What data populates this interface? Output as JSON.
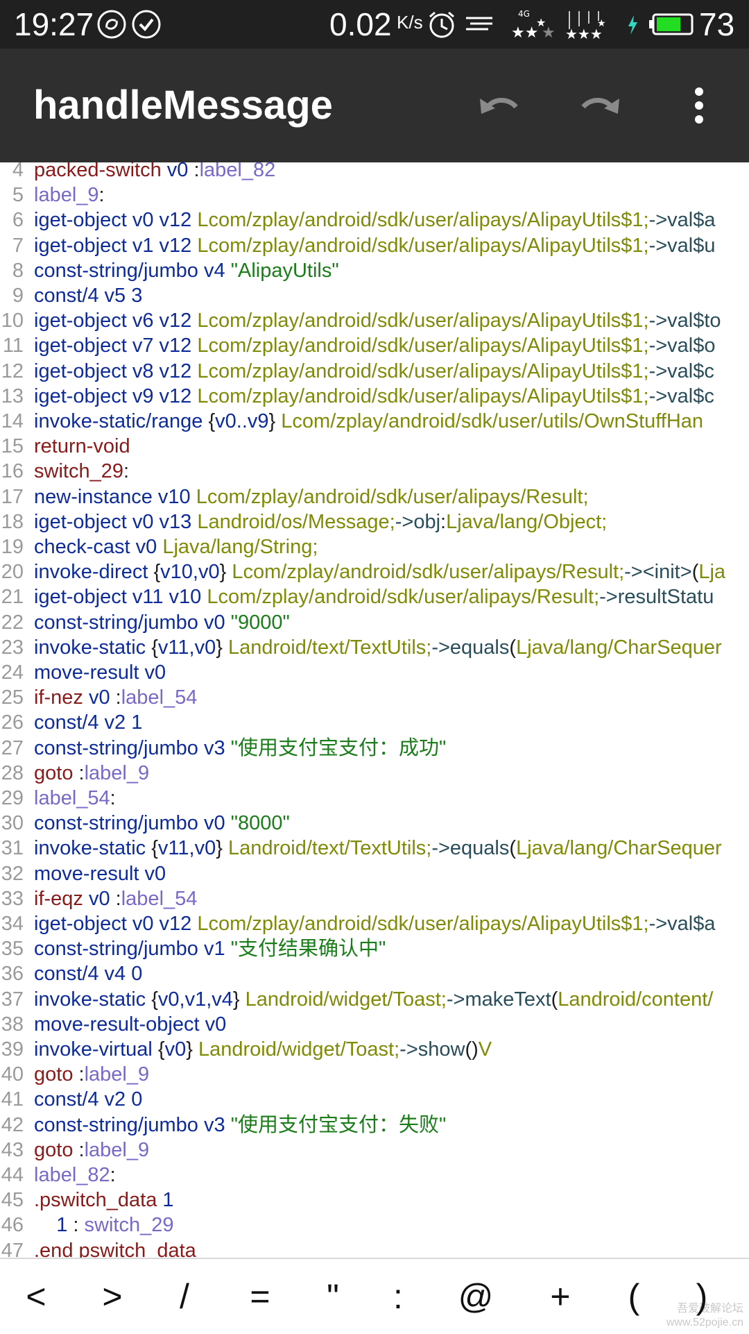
{
  "status_bar": {
    "time": "19:27",
    "speed": "0.02",
    "speed_unit": "K/s",
    "network": "4G",
    "battery_level": "73",
    "icons": [
      "sync-icon",
      "check-circle-icon",
      "alarm-icon",
      "menu-lines-icon",
      "signal-stars-icon",
      "signal-stars-icon",
      "charging-bolt-icon",
      "battery-icon"
    ]
  },
  "toolbar": {
    "title": "handleMessage",
    "icons": [
      "undo-icon",
      "redo-icon",
      "more-vert-icon"
    ]
  },
  "editor": {
    "lines": [
      {
        "n": "4",
        "tokens": [
          {
            "t": "packed-switch",
            "c": "ctrl"
          },
          {
            "t": " v0 ",
            "c": "reg"
          },
          {
            "t": ":",
            "c": "punct"
          },
          {
            "t": "label_82",
            "c": "label"
          }
        ]
      },
      {
        "n": "5",
        "tokens": [
          {
            "t": "label_9",
            "c": "label"
          },
          {
            "t": ":",
            "c": "punct"
          }
        ]
      },
      {
        "n": "6",
        "tokens": [
          {
            "t": "iget-object",
            "c": "op"
          },
          {
            "t": " v0 v12 ",
            "c": "reg"
          },
          {
            "t": "Lcom/zplay/android/sdk/user/alipays/AlipayUtils$1;",
            "c": "type"
          },
          {
            "t": "->",
            "c": "member"
          },
          {
            "t": "val$a",
            "c": "member"
          }
        ]
      },
      {
        "n": "7",
        "tokens": [
          {
            "t": "iget-object",
            "c": "op"
          },
          {
            "t": " v1 v12 ",
            "c": "reg"
          },
          {
            "t": "Lcom/zplay/android/sdk/user/alipays/AlipayUtils$1;",
            "c": "type"
          },
          {
            "t": "->",
            "c": "member"
          },
          {
            "t": "val$u",
            "c": "member"
          }
        ]
      },
      {
        "n": "8",
        "tokens": [
          {
            "t": "const-string/jumbo",
            "c": "op"
          },
          {
            "t": " v4 ",
            "c": "reg"
          },
          {
            "t": "\"AlipayUtils\"",
            "c": "str"
          }
        ]
      },
      {
        "n": "9",
        "tokens": [
          {
            "t": "const/4",
            "c": "op"
          },
          {
            "t": " v5 3",
            "c": "reg"
          }
        ]
      },
      {
        "n": "10",
        "tokens": [
          {
            "t": "iget-object",
            "c": "op"
          },
          {
            "t": " v6 v12 ",
            "c": "reg"
          },
          {
            "t": "Lcom/zplay/android/sdk/user/alipays/AlipayUtils$1;",
            "c": "type"
          },
          {
            "t": "->",
            "c": "member"
          },
          {
            "t": "val$to",
            "c": "member"
          }
        ]
      },
      {
        "n": "11",
        "tokens": [
          {
            "t": "iget-object",
            "c": "op"
          },
          {
            "t": " v7 v12 ",
            "c": "reg"
          },
          {
            "t": "Lcom/zplay/android/sdk/user/alipays/AlipayUtils$1;",
            "c": "type"
          },
          {
            "t": "->",
            "c": "member"
          },
          {
            "t": "val$o",
            "c": "member"
          }
        ]
      },
      {
        "n": "12",
        "tokens": [
          {
            "t": "iget-object",
            "c": "op"
          },
          {
            "t": " v8 v12 ",
            "c": "reg"
          },
          {
            "t": "Lcom/zplay/android/sdk/user/alipays/AlipayUtils$1;",
            "c": "type"
          },
          {
            "t": "->",
            "c": "member"
          },
          {
            "t": "val$c",
            "c": "member"
          }
        ]
      },
      {
        "n": "13",
        "tokens": [
          {
            "t": "iget-object",
            "c": "op"
          },
          {
            "t": " v9 v12 ",
            "c": "reg"
          },
          {
            "t": "Lcom/zplay/android/sdk/user/alipays/AlipayUtils$1;",
            "c": "type"
          },
          {
            "t": "->",
            "c": "member"
          },
          {
            "t": "val$c",
            "c": "member"
          }
        ]
      },
      {
        "n": "14",
        "tokens": [
          {
            "t": "invoke-static/range",
            "c": "op"
          },
          {
            "t": " {",
            "c": "punct"
          },
          {
            "t": "v0..v9",
            "c": "reg"
          },
          {
            "t": "} ",
            "c": "punct"
          },
          {
            "t": "Lcom/zplay/android/sdk/user/utils/OwnStuffHan",
            "c": "type"
          }
        ]
      },
      {
        "n": "15",
        "tokens": [
          {
            "t": "return-void",
            "c": "ctrl"
          }
        ]
      },
      {
        "n": "16",
        "tokens": [
          {
            "t": "switch_29",
            "c": "ctrl"
          },
          {
            "t": ":",
            "c": "punct"
          }
        ]
      },
      {
        "n": "17",
        "tokens": [
          {
            "t": "new-instance",
            "c": "op"
          },
          {
            "t": " v10 ",
            "c": "reg"
          },
          {
            "t": "Lcom/zplay/android/sdk/user/alipays/Result;",
            "c": "type"
          }
        ]
      },
      {
        "n": "18",
        "tokens": [
          {
            "t": "iget-object",
            "c": "op"
          },
          {
            "t": " v0 v13 ",
            "c": "reg"
          },
          {
            "t": "Landroid/os/Message;",
            "c": "type"
          },
          {
            "t": "->",
            "c": "member"
          },
          {
            "t": "obj",
            "c": "member"
          },
          {
            "t": ":",
            "c": "punct"
          },
          {
            "t": "Ljava/lang/Object;",
            "c": "type"
          }
        ]
      },
      {
        "n": "19",
        "tokens": [
          {
            "t": "check-cast",
            "c": "op"
          },
          {
            "t": " v0 ",
            "c": "reg"
          },
          {
            "t": "Ljava/lang/String;",
            "c": "type"
          }
        ]
      },
      {
        "n": "20",
        "tokens": [
          {
            "t": "invoke-direct",
            "c": "op"
          },
          {
            "t": " {",
            "c": "punct"
          },
          {
            "t": "v10,v0",
            "c": "reg"
          },
          {
            "t": "} ",
            "c": "punct"
          },
          {
            "t": "Lcom/zplay/android/sdk/user/alipays/Result;",
            "c": "type"
          },
          {
            "t": "-><init>",
            "c": "member"
          },
          {
            "t": "(",
            "c": "punct"
          },
          {
            "t": "Lja",
            "c": "type"
          }
        ]
      },
      {
        "n": "21",
        "tokens": [
          {
            "t": "iget-object",
            "c": "op"
          },
          {
            "t": " v11 v10 ",
            "c": "reg"
          },
          {
            "t": "Lcom/zplay/android/sdk/user/alipays/Result;",
            "c": "type"
          },
          {
            "t": "->",
            "c": "member"
          },
          {
            "t": "resultStatu",
            "c": "member"
          }
        ]
      },
      {
        "n": "22",
        "tokens": [
          {
            "t": "const-string/jumbo",
            "c": "op"
          },
          {
            "t": " v0 ",
            "c": "reg"
          },
          {
            "t": "\"9000\"",
            "c": "str"
          }
        ]
      },
      {
        "n": "23",
        "tokens": [
          {
            "t": "invoke-static",
            "c": "op"
          },
          {
            "t": " {",
            "c": "punct"
          },
          {
            "t": "v11,v0",
            "c": "reg"
          },
          {
            "t": "} ",
            "c": "punct"
          },
          {
            "t": "Landroid/text/TextUtils;",
            "c": "type"
          },
          {
            "t": "->",
            "c": "member"
          },
          {
            "t": "equals",
            "c": "member"
          },
          {
            "t": "(",
            "c": "punct"
          },
          {
            "t": "Ljava/lang/CharSequer",
            "c": "type"
          }
        ]
      },
      {
        "n": "24",
        "tokens": [
          {
            "t": "move-result",
            "c": "op"
          },
          {
            "t": " v0",
            "c": "reg"
          }
        ]
      },
      {
        "n": "25",
        "tokens": [
          {
            "t": "if-nez",
            "c": "ctrl"
          },
          {
            "t": " v0 ",
            "c": "reg"
          },
          {
            "t": ":",
            "c": "punct"
          },
          {
            "t": "label_54",
            "c": "label"
          }
        ]
      },
      {
        "n": "26",
        "tokens": [
          {
            "t": "const/4",
            "c": "op"
          },
          {
            "t": " v2 1",
            "c": "reg"
          }
        ]
      },
      {
        "n": "27",
        "tokens": [
          {
            "t": "const-string/jumbo",
            "c": "op"
          },
          {
            "t": " v3 ",
            "c": "reg"
          },
          {
            "t": "\"使用支付宝支付：成功\"",
            "c": "str"
          }
        ]
      },
      {
        "n": "28",
        "tokens": [
          {
            "t": "goto",
            "c": "ctrl"
          },
          {
            "t": " :",
            "c": "punct"
          },
          {
            "t": "label_9",
            "c": "label"
          }
        ]
      },
      {
        "n": "29",
        "tokens": [
          {
            "t": "label_54",
            "c": "label"
          },
          {
            "t": ":",
            "c": "punct"
          }
        ]
      },
      {
        "n": "30",
        "tokens": [
          {
            "t": "const-string/jumbo",
            "c": "op"
          },
          {
            "t": " v0 ",
            "c": "reg"
          },
          {
            "t": "\"8000\"",
            "c": "str"
          }
        ]
      },
      {
        "n": "31",
        "tokens": [
          {
            "t": "invoke-static",
            "c": "op"
          },
          {
            "t": " {",
            "c": "punct"
          },
          {
            "t": "v11,v0",
            "c": "reg"
          },
          {
            "t": "} ",
            "c": "punct"
          },
          {
            "t": "Landroid/text/TextUtils;",
            "c": "type"
          },
          {
            "t": "->",
            "c": "member"
          },
          {
            "t": "equals",
            "c": "member"
          },
          {
            "t": "(",
            "c": "punct"
          },
          {
            "t": "Ljava/lang/CharSequer",
            "c": "type"
          }
        ]
      },
      {
        "n": "32",
        "tokens": [
          {
            "t": "move-result",
            "c": "op"
          },
          {
            "t": " v0",
            "c": "reg"
          }
        ]
      },
      {
        "n": "33",
        "tokens": [
          {
            "t": "if-eqz",
            "c": "ctrl"
          },
          {
            "t": " v0 ",
            "c": "reg"
          },
          {
            "t": ":",
            "c": "punct"
          },
          {
            "t": "label_54",
            "c": "label"
          }
        ]
      },
      {
        "n": "34",
        "tokens": [
          {
            "t": "iget-object",
            "c": "op"
          },
          {
            "t": " v0 v12 ",
            "c": "reg"
          },
          {
            "t": "Lcom/zplay/android/sdk/user/alipays/AlipayUtils$1;",
            "c": "type"
          },
          {
            "t": "->",
            "c": "member"
          },
          {
            "t": "val$a",
            "c": "member"
          }
        ]
      },
      {
        "n": "35",
        "tokens": [
          {
            "t": "const-string/jumbo",
            "c": "op"
          },
          {
            "t": " v1 ",
            "c": "reg"
          },
          {
            "t": "\"支付结果确认中\"",
            "c": "str"
          }
        ]
      },
      {
        "n": "36",
        "tokens": [
          {
            "t": "const/4",
            "c": "op"
          },
          {
            "t": " v4 0",
            "c": "reg"
          }
        ]
      },
      {
        "n": "37",
        "tokens": [
          {
            "t": "invoke-static",
            "c": "op"
          },
          {
            "t": " {",
            "c": "punct"
          },
          {
            "t": "v0,v1,v4",
            "c": "reg"
          },
          {
            "t": "} ",
            "c": "punct"
          },
          {
            "t": "Landroid/widget/Toast;",
            "c": "type"
          },
          {
            "t": "->",
            "c": "member"
          },
          {
            "t": "makeText",
            "c": "member"
          },
          {
            "t": "(",
            "c": "punct"
          },
          {
            "t": "Landroid/content/",
            "c": "type"
          }
        ]
      },
      {
        "n": "38",
        "tokens": [
          {
            "t": "move-result-object",
            "c": "op"
          },
          {
            "t": " v0",
            "c": "reg"
          }
        ]
      },
      {
        "n": "39",
        "tokens": [
          {
            "t": "invoke-virtual",
            "c": "op"
          },
          {
            "t": " {",
            "c": "punct"
          },
          {
            "t": "v0",
            "c": "reg"
          },
          {
            "t": "} ",
            "c": "punct"
          },
          {
            "t": "Landroid/widget/Toast;",
            "c": "type"
          },
          {
            "t": "->",
            "c": "member"
          },
          {
            "t": "show",
            "c": "member"
          },
          {
            "t": "()",
            "c": "punct"
          },
          {
            "t": "V",
            "c": "type"
          }
        ]
      },
      {
        "n": "40",
        "tokens": [
          {
            "t": "goto",
            "c": "ctrl"
          },
          {
            "t": " :",
            "c": "punct"
          },
          {
            "t": "label_9",
            "c": "label"
          }
        ]
      },
      {
        "n": "41",
        "tokens": [
          {
            "t": "const/4",
            "c": "op"
          },
          {
            "t": " v2 0",
            "c": "reg"
          }
        ]
      },
      {
        "n": "42",
        "tokens": [
          {
            "t": "const-string/jumbo",
            "c": "op"
          },
          {
            "t": " v3 ",
            "c": "reg"
          },
          {
            "t": "\"使用支付宝支付：失败\"",
            "c": "str"
          }
        ]
      },
      {
        "n": "43",
        "tokens": [
          {
            "t": "goto",
            "c": "ctrl"
          },
          {
            "t": " :",
            "c": "punct"
          },
          {
            "t": "label_9",
            "c": "label"
          }
        ]
      },
      {
        "n": "44",
        "tokens": [
          {
            "t": "label_82",
            "c": "label"
          },
          {
            "t": ":",
            "c": "punct"
          }
        ]
      },
      {
        "n": "45",
        "tokens": [
          {
            "t": ".pswitch_data",
            "c": "ctrl"
          },
          {
            "t": " 1",
            "c": "reg"
          }
        ]
      },
      {
        "n": "46",
        "tokens": [
          {
            "t": "    1",
            "c": "reg"
          },
          {
            "t": " : ",
            "c": "punct"
          },
          {
            "t": "switch_29",
            "c": "label"
          }
        ]
      },
      {
        "n": "47",
        "tokens": [
          {
            "t": ".end pswitch_data",
            "c": "ctrl"
          }
        ]
      }
    ]
  },
  "symbol_bar": {
    "keys": [
      "<",
      ">",
      "/",
      "=",
      "\"",
      ":",
      "@",
      "+",
      "(",
      ")"
    ]
  },
  "watermark": {
    "line1": "吾爱破解论坛",
    "line2": "www.52pojie.cn"
  }
}
